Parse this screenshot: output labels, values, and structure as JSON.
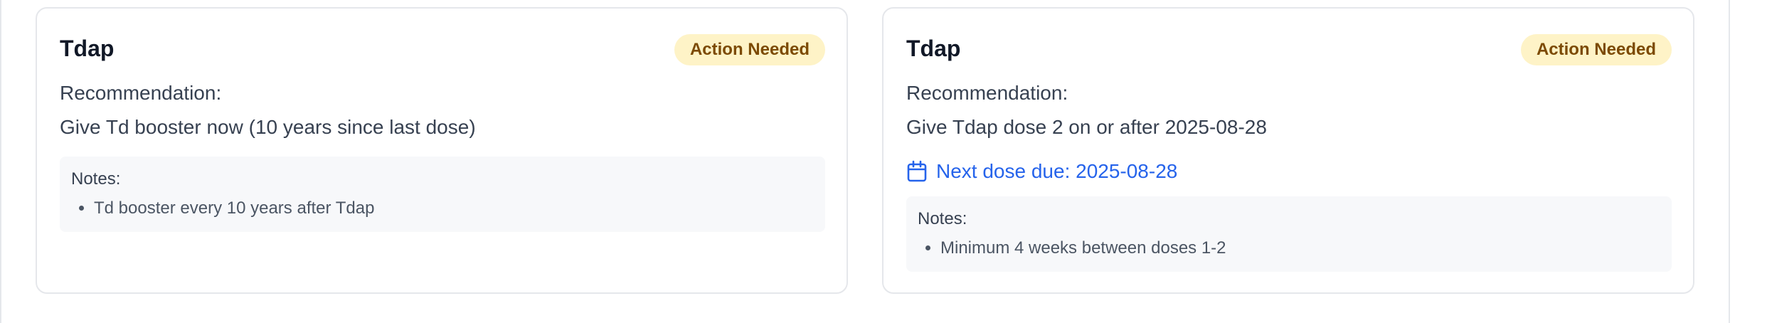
{
  "cards": [
    {
      "title": "Tdap",
      "status": "Action Needed",
      "recommendation_label": "Recommendation:",
      "recommendation": "Give Td booster now (10 years since last dose)",
      "notes_label": "Notes:",
      "notes": [
        "Td booster every 10 years after Tdap"
      ]
    },
    {
      "title": "Tdap",
      "status": "Action Needed",
      "recommendation_label": "Recommendation:",
      "recommendation": "Give Tdap dose 2 on or after 2025-08-28",
      "next_due": "Next dose due: 2025-08-28",
      "next_due_icon": "calendar-icon",
      "notes_label": "Notes:",
      "notes": [
        "Minimum 4 weeks between doses 1-2"
      ]
    }
  ],
  "colors": {
    "badge_bg": "#fef3c7",
    "badge_text": "#7c4a03",
    "link_blue": "#2563eb",
    "border": "#e5e7eb",
    "notes_bg": "#f7f8fa"
  }
}
